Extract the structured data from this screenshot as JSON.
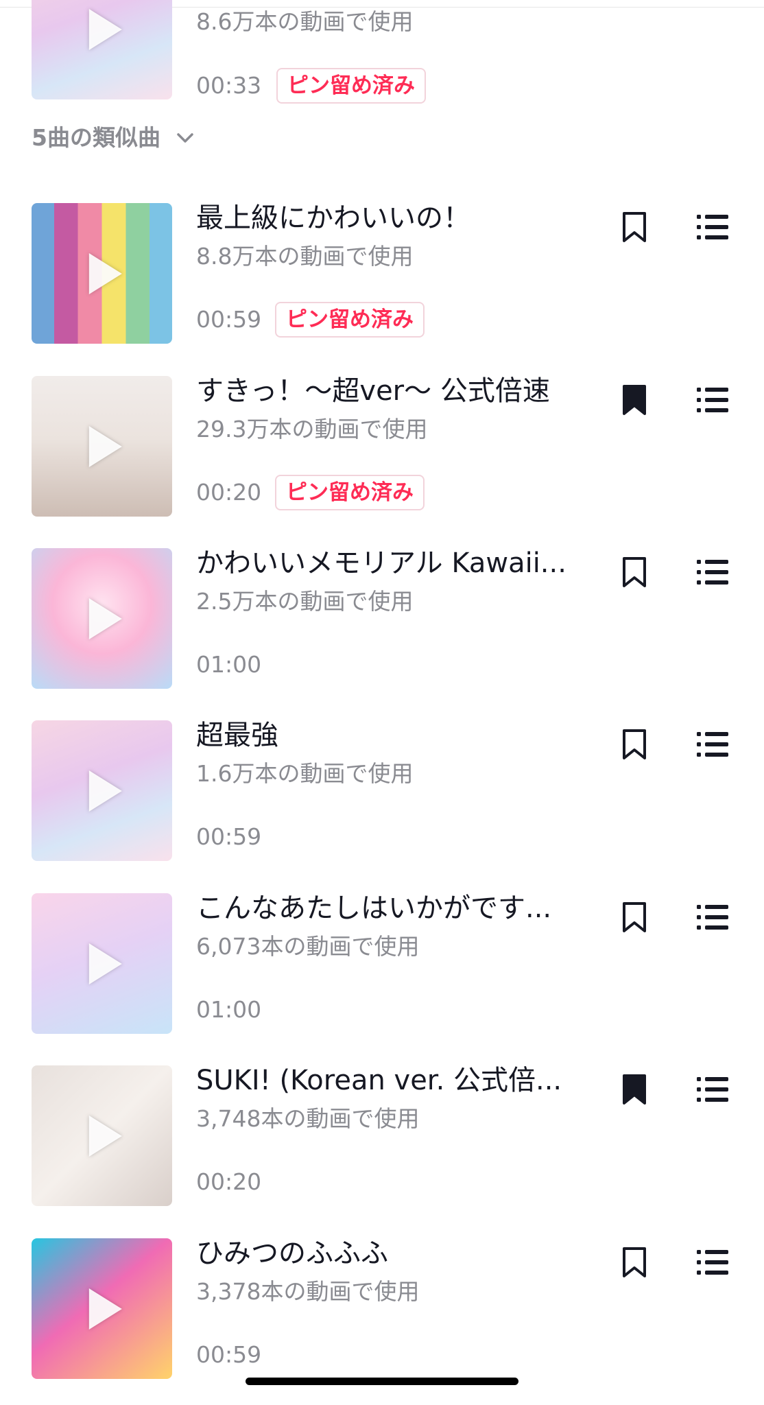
{
  "partial_top": {
    "usage": "8.6万本の動画で使用",
    "duration": "00:33",
    "pinned_label": "ピン留め済み"
  },
  "similar_toggle": {
    "label": "5曲の類似曲",
    "icon": "chevron-down-icon"
  },
  "tracks": [
    {
      "title": "最上級にかわいいの！",
      "usage": "8.8万本の動画で使用",
      "duration": "00:59",
      "pinned_label": "ピン留め済み",
      "bookmarked": false
    },
    {
      "title": "すきっ！〜超ver〜 公式倍速",
      "usage": "29.3万本の動画で使用",
      "duration": "00:20",
      "pinned_label": "ピン留め済み",
      "bookmarked": true
    },
    {
      "title": "かわいいメモリアル Kawaii...",
      "usage": "2.5万本の動画で使用",
      "duration": "01:00",
      "pinned_label": "",
      "bookmarked": false
    },
    {
      "title": "超最強",
      "usage": "1.6万本の動画で使用",
      "duration": "00:59",
      "pinned_label": "",
      "bookmarked": false
    },
    {
      "title": "こんなあたしはいかがです...",
      "usage": "6,073本の動画で使用",
      "duration": "01:00",
      "pinned_label": "",
      "bookmarked": false
    },
    {
      "title": "SUKI! (Korean ver. 公式倍...",
      "usage": "3,748本の動画で使用",
      "duration": "00:20",
      "pinned_label": "",
      "bookmarked": true
    },
    {
      "title": "ひみつのふふふ",
      "usage": "3,378本の動画で使用",
      "duration": "00:59",
      "pinned_label": "",
      "bookmarked": false
    }
  ],
  "colors": {
    "pin_text": "#fe2c55",
    "secondary_text": "#8a8b91",
    "primary_text": "#161823"
  }
}
